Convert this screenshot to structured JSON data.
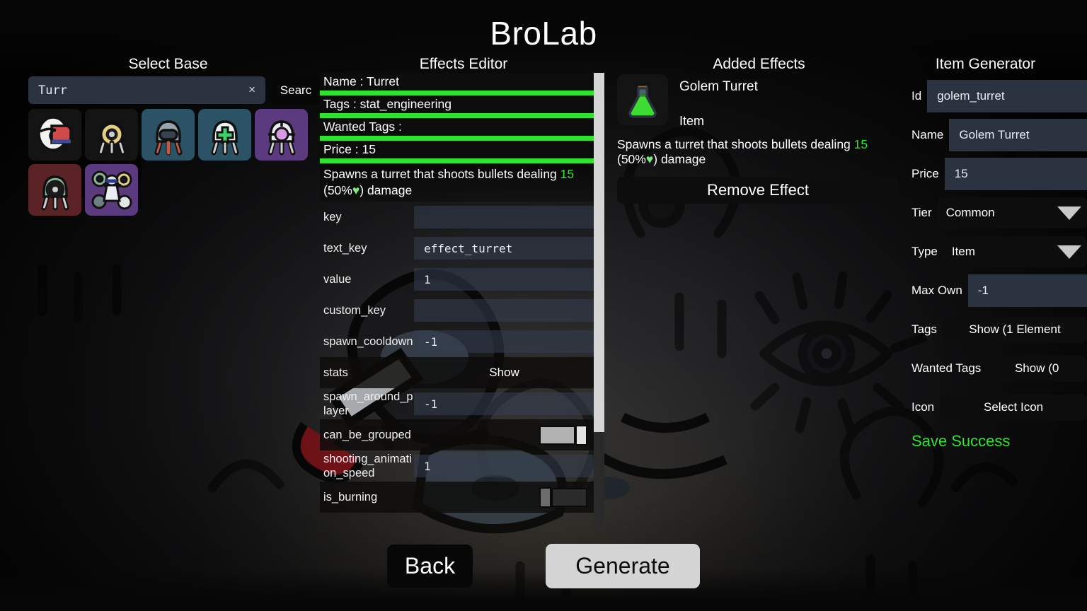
{
  "app": {
    "title": "BroLab"
  },
  "select_base": {
    "title": "Select Base",
    "search": {
      "value": "Turr",
      "placeholder": "",
      "clear_label": "×",
      "button_label": "Searc"
    },
    "bases": [
      {
        "name": "base-crewmate-red",
        "bg": "#141414",
        "body": "#f2f2f2",
        "accent": "#cf4a4a",
        "selected": false
      },
      {
        "name": "base-turret-gold",
        "bg": "#141414",
        "body": "#0f0f0f",
        "accent": "#e3cf7e",
        "selected": false
      },
      {
        "name": "base-turret-gray",
        "bg": "#2c5266",
        "body": "#9aa4ab",
        "accent": "#c05a45",
        "selected": true
      },
      {
        "name": "base-turret-medic",
        "bg": "#2c5266",
        "body": "#eef1f0",
        "accent": "#3fd16a",
        "selected": true
      },
      {
        "name": "base-turret-purple",
        "bg": "#5b3a80",
        "body": "#e9eaee",
        "accent": "#d59ae0",
        "selected": true
      },
      {
        "name": "base-turret-green",
        "bg": "#5c2326",
        "body": "#8fb79c",
        "accent": "#1a1a1a",
        "selected": true
      },
      {
        "name": "base-golem-turret",
        "bg": "#5b3a80",
        "body": "#dfe2e6",
        "accent": "#7fa890",
        "selected": true
      }
    ]
  },
  "effects_editor": {
    "title": "Effects Editor",
    "header": [
      {
        "label": "Name",
        "sep": " : ",
        "value": "Turret"
      },
      {
        "label": "Tags",
        "sep": " : ",
        "value": "stat_engineering"
      },
      {
        "label": "Wanted Tags",
        "sep": " : ",
        "value": ""
      },
      {
        "label": "Price",
        "sep": " : ",
        "value": "15"
      }
    ],
    "description": {
      "pre": "Spawns a turret that shoots bullets dealing ",
      "num": "15",
      "mid": " (",
      "pct": "50%",
      "heart": "♥",
      "post": ") damage"
    },
    "properties": [
      {
        "key": "key",
        "type": "text",
        "value": "",
        "dark": false
      },
      {
        "key": "text_key",
        "type": "text",
        "value": "effect_turret",
        "dark": false
      },
      {
        "key": "value",
        "type": "text",
        "value": "1",
        "dark": false
      },
      {
        "key": "custom_key",
        "type": "text",
        "value": "",
        "dark": false
      },
      {
        "key": "spawn_cooldown",
        "type": "text",
        "value": "-1",
        "dark": false
      },
      {
        "key": "stats",
        "type": "button",
        "value": "Show",
        "dark": true
      },
      {
        "key": "spawn_around_player",
        "type": "text",
        "value": "-1",
        "dark": false
      },
      {
        "key": "can_be_grouped",
        "type": "toggle",
        "value": "on",
        "dark": true
      },
      {
        "key": "shooting_animation_speed",
        "type": "text",
        "value": "1",
        "dark": false
      },
      {
        "key": "is_burning",
        "type": "toggle",
        "value": "off",
        "dark": true
      }
    ],
    "scrollbar": {
      "thumb_percent": 79
    }
  },
  "added_effects": {
    "title": "Added Effects",
    "effect": {
      "icon": "potion-flask-icon",
      "name": "Golem Turret",
      "type": "Item",
      "description": {
        "pre": "Spawns a turret that shoots bullets dealing ",
        "num": "15",
        "mid": " (",
        "pct": "50%",
        "heart": "♥",
        "post": ") damage"
      }
    },
    "remove_label": "Remove Effect"
  },
  "item_generator": {
    "title": "Item Generator",
    "fields": [
      {
        "label": "Id",
        "value": "golem_turret",
        "kind": "input"
      },
      {
        "label": "Name",
        "value": "Golem Turret",
        "kind": "input"
      },
      {
        "label": "Price",
        "value": "15",
        "kind": "input"
      },
      {
        "label": "Tier",
        "value": "Common",
        "kind": "select"
      },
      {
        "label": "Type",
        "value": "Item",
        "kind": "select"
      },
      {
        "label": "Max Own",
        "value": "-1",
        "kind": "input"
      },
      {
        "label": "Tags",
        "value": "Show (1 Element",
        "kind": "button"
      },
      {
        "label": "Wanted Tags",
        "value": "Show (0",
        "kind": "button"
      },
      {
        "label": "Icon",
        "value": "Select Icon",
        "kind": "button"
      }
    ],
    "status": "Save Success"
  },
  "footer": {
    "back_label": "Back",
    "generate_label": "Generate"
  },
  "colors": {
    "accent_green": "#2fe32f",
    "input_bg": "#2b3240",
    "panel_bg": "#0d0d0d",
    "generate_bg": "#d4d4d4"
  }
}
